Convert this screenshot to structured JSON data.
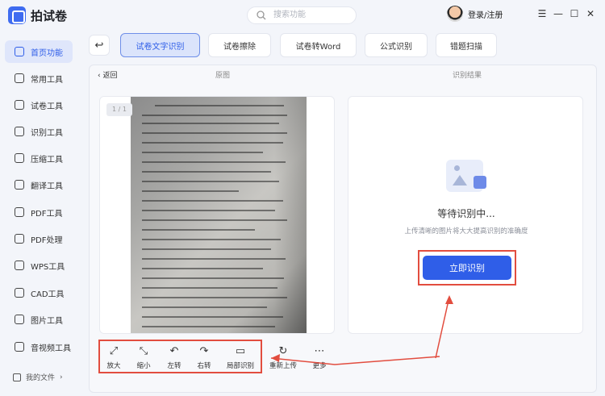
{
  "app": {
    "name": "拍试卷"
  },
  "search": {
    "placeholder": "搜索功能"
  },
  "user": {
    "login_label": "登录/注册"
  },
  "window": {
    "menu_glyph": "☰",
    "min_glyph": "—",
    "max_glyph": "☐",
    "close_glyph": "✕"
  },
  "sidebar": {
    "items": [
      {
        "label": "首页功能",
        "icon": "home-icon",
        "active": true
      },
      {
        "label": "常用工具",
        "icon": "layers-icon"
      },
      {
        "label": "试卷工具",
        "icon": "paper-icon"
      },
      {
        "label": "识别工具",
        "icon": "scan-icon"
      },
      {
        "label": "压缩工具",
        "icon": "compress-icon"
      },
      {
        "label": "翻译工具",
        "icon": "translate-icon"
      },
      {
        "label": "PDF工具",
        "icon": "pdf-icon"
      },
      {
        "label": "PDF处理",
        "icon": "pdf-process-icon"
      },
      {
        "label": "WPS工具",
        "icon": "wps-icon"
      },
      {
        "label": "CAD工具",
        "icon": "cad-icon"
      },
      {
        "label": "图片工具",
        "icon": "image-icon"
      },
      {
        "label": "音视频工具",
        "icon": "media-icon"
      }
    ],
    "my_files": "我的文件"
  },
  "tabs": [
    {
      "label": "试卷文字识别",
      "active": true
    },
    {
      "label": "试卷擦除"
    },
    {
      "label": "试卷转Word"
    },
    {
      "label": "公式识别"
    },
    {
      "label": "错题扫描"
    }
  ],
  "panel": {
    "back_label": "返回",
    "original_label": "原图",
    "result_label": "识别结果",
    "page_indicator": "1 / 1",
    "waiting_text": "等待识别中...",
    "hint_text": "上传清晰的图片将大大提高识别的准确度",
    "recognize_button": "立即识别"
  },
  "tools": [
    {
      "label": "放大",
      "icon": "zoom-in-icon",
      "glyph": "⤢"
    },
    {
      "label": "缩小",
      "icon": "zoom-out-icon",
      "glyph": "⤡"
    },
    {
      "label": "左转",
      "icon": "rotate-left-icon",
      "glyph": "↶"
    },
    {
      "label": "右转",
      "icon": "rotate-right-icon",
      "glyph": "↷"
    },
    {
      "label": "局部识别",
      "icon": "crop-icon",
      "glyph": "▭"
    },
    {
      "label": "重新上传",
      "icon": "reupload-icon",
      "glyph": "↻"
    },
    {
      "label": "更多",
      "icon": "more-icon",
      "glyph": "⋯"
    }
  ],
  "colors": {
    "accent": "#2f5ee8",
    "annotation": "#e24d3f"
  }
}
